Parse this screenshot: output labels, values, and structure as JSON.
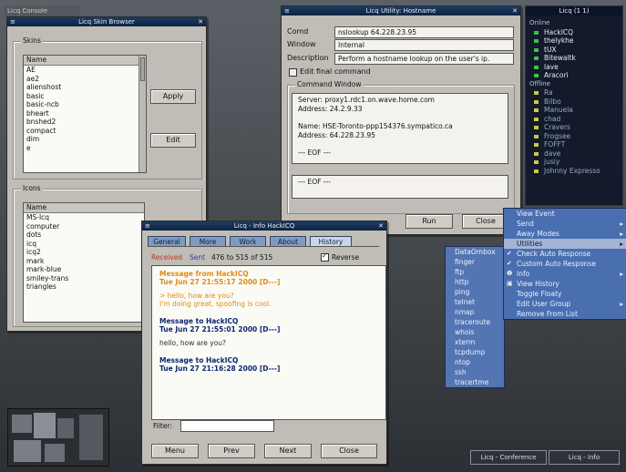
{
  "desktop": {
    "corner_title": "Licq Console"
  },
  "skins": {
    "title": "Licq Skin Browser",
    "skins_group": "Skins",
    "skins_header": "Name",
    "skins_items": [
      "AE",
      "ae2",
      "alienshost",
      "basic",
      "basic-ncb",
      "bheart",
      "bnshed2",
      "compact",
      "dim",
      "e"
    ],
    "icons_group": "Icons",
    "icons_header": "Name",
    "icons_items": [
      "MS-Icq",
      "computer",
      "dots",
      "icq",
      "icq2",
      "mark",
      "mark-blue",
      "smiley-trans",
      "triangles"
    ],
    "apply_label": "Apply",
    "edit_label": "Edit"
  },
  "utility": {
    "title": "Licq Utility: Hostname",
    "command_label": "Comd",
    "command_value": "nslookup 64.228.23.95",
    "window_label": "Window",
    "window_value": "Internal",
    "desc_label": "Description",
    "desc_value": "Perform a hostname lookup on the user's ip.",
    "edit_final_label": "Edit final command",
    "cmd_window_label": "Command Window",
    "output": [
      "Server:  proxy1.rdc1.on.wave.home.com",
      "Address: 24.2.9.33",
      "",
      "Name:    HSE-Toronto-ppp154376.sympatico.ca",
      "Address: 64.228.23.95",
      "",
      "--- EOF ---"
    ],
    "output2": "--- EOF ---",
    "run_label": "Run",
    "close_label": "Close"
  },
  "history": {
    "title": "Licq - Info HackICQ",
    "tabs": [
      "General",
      "More",
      "Work",
      "About",
      "History"
    ],
    "received_label": "Received",
    "sent_label": "Sent",
    "range_label": "476 to 515 of 515",
    "reverse_label": "Reverse",
    "messages": [
      {
        "dir": "in",
        "header1": "Message from HackICQ",
        "header2": "Tue Jun 27 21:55:17 2000 [D---]",
        "lines": [
          "> hello, how are you?",
          "I'm doing great, spoofing is cool."
        ]
      },
      {
        "dir": "out",
        "header1": "Message to HackICQ",
        "header2": "Tue Jun 27 21:55:01 2000 [D---]",
        "lines": [
          "hello, how are you?"
        ]
      },
      {
        "dir": "out",
        "header1": "Message to HackICQ",
        "header2": "Tue Jun 27 21:16:28 2000 [D---]",
        "lines": []
      }
    ],
    "filter_label": "Filter:",
    "menu_label": "Menu",
    "prev_label": "Prev",
    "next_label": "Next",
    "close_label": "Close"
  },
  "contacts": {
    "title": "Licq (1 1)",
    "online_header": "Online",
    "online": [
      "HackICQ",
      "thelykhe",
      "tUX",
      "Bitewaltk",
      "lave",
      "Aracori"
    ],
    "offline_header": "Offline",
    "offline": [
      "Ra",
      "Bilbo",
      "Manuela",
      "chad",
      "Cravers",
      "Frogsee",
      "FOFFT",
      "dave",
      "jusiy",
      "Johnny Expresso"
    ]
  },
  "context_menu": {
    "items": [
      "View Event",
      "Send",
      "Away Modes",
      "Utilities",
      "Check Auto Response",
      "Custom Auto Response",
      "Info",
      "View History",
      "Toggle Floaty",
      "Edit User Group",
      "Remove From List"
    ],
    "highlighted": "Utilities",
    "has_submenu": [
      "Send",
      "Away Modes",
      "Utilities",
      "Info",
      "Edit User Group"
    ]
  },
  "submenu": {
    "items": [
      "DataOmbox",
      "finger",
      "ftp",
      "http",
      "ping",
      "telnet",
      "nmap",
      "traceroute",
      "whois",
      "xterm",
      "tcpdump",
      "ntop",
      "ssh",
      "tracertme"
    ]
  },
  "taskbar": {
    "item1": "Licq - Conference",
    "item2": "Licq - Info"
  }
}
